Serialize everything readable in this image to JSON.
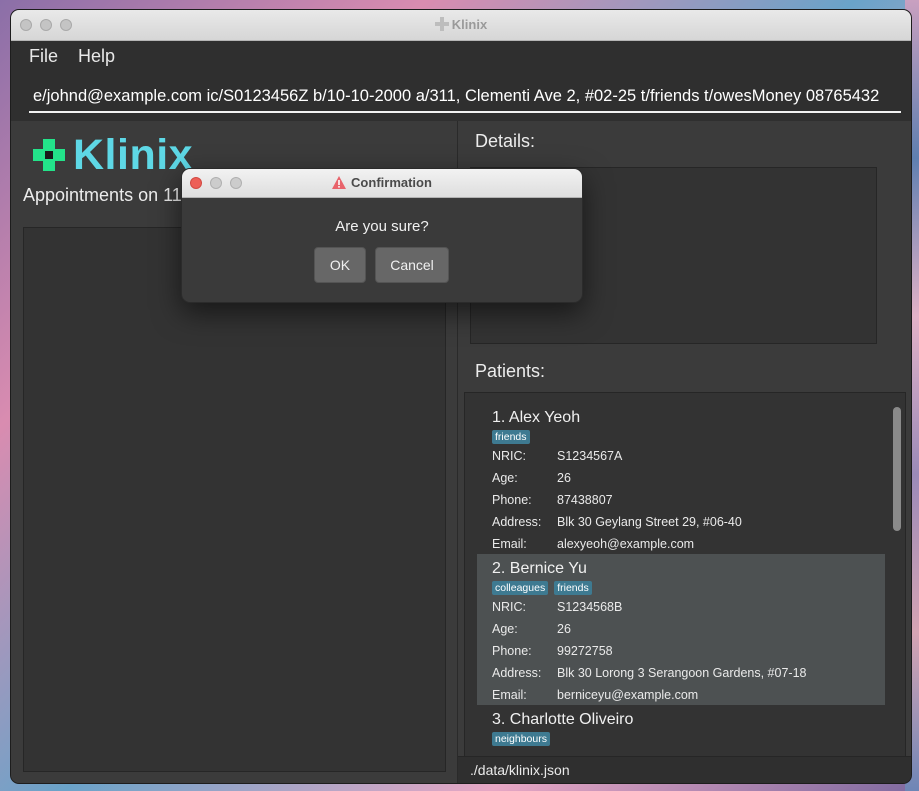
{
  "window": {
    "title": "Klinix"
  },
  "menu": {
    "file": "File",
    "help": "Help"
  },
  "command": {
    "value": "08765432 e/johnd@example.com ic/S0123456Z b/10-10-2000 a/311, Clementi Ave 2, #02-25 t/friends t/owesMoney"
  },
  "left": {
    "logo_text": "Klinix",
    "appointments_title": "Appointments on 11-"
  },
  "right": {
    "details_title": "Details:",
    "patients_title": "Patients:"
  },
  "field_labels": {
    "nric": "NRIC:",
    "age": "Age:",
    "phone": "Phone:",
    "address": "Address:",
    "email": "Email:"
  },
  "patients": [
    {
      "name": "1. Alex Yeoh",
      "tags": [
        "friends"
      ],
      "nric": "S1234567A",
      "age": "26",
      "phone": "87438807",
      "address": "Blk 30 Geylang Street 29, #06-40",
      "email": "alexyeoh@example.com"
    },
    {
      "name": "2. Bernice Yu",
      "tags": [
        "colleagues",
        "friends"
      ],
      "nric": "S1234568B",
      "age": "26",
      "phone": "99272758",
      "address": "Blk 30 Lorong 3 Serangoon Gardens, #07-18",
      "email": "berniceyu@example.com"
    },
    {
      "name": "3. Charlotte Oliveiro",
      "tags": [
        "neighbours"
      ]
    }
  ],
  "status": {
    "path": "./data/klinix.json"
  },
  "dialog": {
    "title": "Confirmation",
    "message": "Are you sure?",
    "ok_label": "OK",
    "cancel_label": "Cancel"
  },
  "colors": {
    "accent_green": "#23e38a",
    "accent_cyan": "#5ed8e6",
    "tag_bg": "#3e7a91",
    "close_red": "#ed5f57"
  }
}
